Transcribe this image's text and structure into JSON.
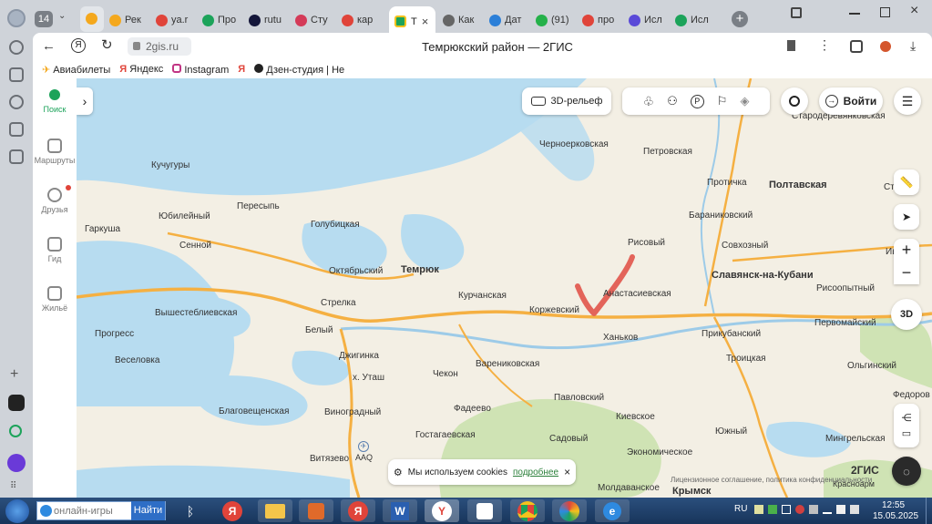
{
  "browser": {
    "tab_count": "14",
    "tabs": [
      {
        "label": "Рек",
        "color": "#f4a81d"
      },
      {
        "label": "ya.r",
        "color": "#e0443a"
      },
      {
        "label": "Про",
        "color": "#1ca35a"
      },
      {
        "label": "rutu",
        "color": "#14163a"
      },
      {
        "label": "Сту",
        "color": "#d43a58"
      },
      {
        "label": "кар",
        "color": "#e0443a"
      }
    ],
    "active_tab": {
      "label": "Т",
      "close": "×"
    },
    "tabs_after": [
      {
        "label": "Как",
        "color": "#666"
      },
      {
        "label": "Дат",
        "color": "#2b7fd8"
      },
      {
        "label": "(91)",
        "color": "#25b14a"
      },
      {
        "label": "про",
        "color": "#e0443a"
      },
      {
        "label": "Исл",
        "color": "#5a4ad8"
      },
      {
        "label": "Исл",
        "color": "#1ca35a"
      }
    ],
    "new_tab": "+",
    "url": "2gis.ru",
    "page_title": "Темрюкский район — 2ГИС",
    "bookmarks": [
      "Авиабилеты",
      "Яндекс",
      "Instagram",
      "Дзен-студия | Не"
    ]
  },
  "left_panel": {
    "items": [
      {
        "label": "Поиск"
      },
      {
        "label": "Маршруты"
      },
      {
        "label": "Друзья"
      },
      {
        "label": "Гид"
      },
      {
        "label": "Жильё"
      }
    ]
  },
  "map_controls": {
    "relief": "3D-рельеф",
    "login": "Войти",
    "plus": "+",
    "minus": "−",
    "d3": "3D",
    "expand": "›"
  },
  "map_labels": {
    "staroderevyan": "Стародеревянковская",
    "chernoerkovskaya": "Черноерковская",
    "petrovskaya": "Петровская",
    "protichka": "Протичка",
    "poltavskaya": "Полтавская",
    "staroni": "Старони",
    "kuchugury": "Кучугуры",
    "peresyp": "Пересыпь",
    "golubitskaya": "Голубицкая",
    "yubileyny": "Юбилейный",
    "garkusha": "Гаркуша",
    "sennoy": "Сенной",
    "baranikovsky": "Бараниковский",
    "risovy": "Рисовый",
    "sovkhozny": "Совхозный",
    "ivanovskaya": "Ив",
    "oktyabrsky": "Октябрьский",
    "temryuk": "Темрюк",
    "slavyansk": "Славянск-на-Кубани",
    "anastasievskaya": "Анастасиевская",
    "risoopytny": "Рисоопытный",
    "kurchanskaya": "Курчанская",
    "strelka": "Стрелка",
    "vyshesteblievskaya": "Вышестеблиевская",
    "korzhevsky": "Коржевский",
    "pervomaysky": "Первомайский",
    "belyy": "Белый",
    "progress": "Прогресс",
    "prikubansky": "Прикубанский",
    "khankov": "Ханьков",
    "veselovka": "Веселовка",
    "dzhiginka": "Джигинка",
    "varenikovskaya": "Варениковская",
    "troitskaya": "Троицкая",
    "olginsky": "Ольгинский",
    "kh_utash": "х. Уташ",
    "chekon": "Чекон",
    "fedorov": "Федоров",
    "pavlovsky": "Павловский",
    "fadeevo": "Фадеево",
    "blagoveshchenskaya": "Благовещенская",
    "vinogradny": "Виноградный",
    "kievskoe": "Киевское",
    "gostagaevskaya": "Гостагаевская",
    "yuzhny": "Южный",
    "mingrelskaya": "Мингрельская",
    "sadovy": "Садовый",
    "vityazevo": "Витязево",
    "aaq": "AAQ",
    "ekonomicheskoe": "Экономическое",
    "moldavanskoe": "Молдаванское",
    "krymsk": "Крымск",
    "krasnoarm": "Красноарм",
    "logo": "2ГИС",
    "license": "Лицензионное соглашение, политика конфиденциальности"
  },
  "cookie": {
    "text": "Мы используем cookies",
    "link": "подробнее",
    "close": "×"
  },
  "taskbar": {
    "search_placeholder": "онлайн-игры",
    "search_button": "Найти",
    "lang": "RU",
    "time": "12:55",
    "date": "15.05.2025"
  },
  "colors": {
    "water": "#b7dcf0",
    "land": "#f3efe4",
    "green": "#cfe3b4",
    "road": "#f5b042",
    "annotation": "#e3645a"
  }
}
